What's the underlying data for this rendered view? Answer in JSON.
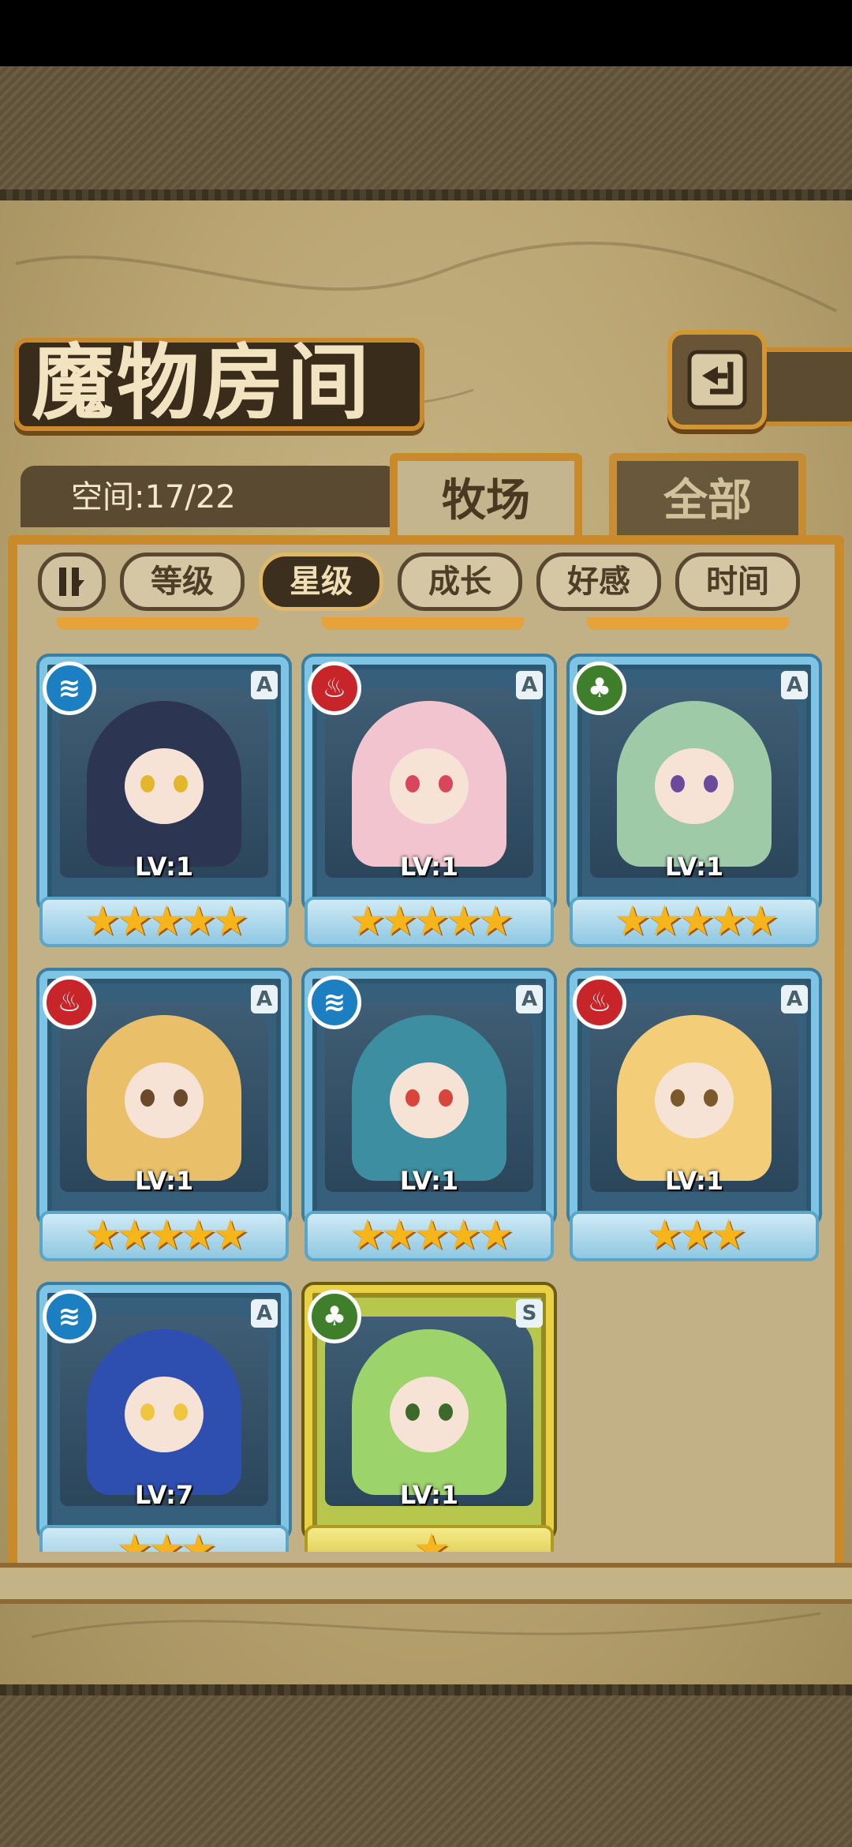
{
  "title": "魔物房间",
  "space": {
    "label": "空间:17/22"
  },
  "tabs": [
    {
      "label": "牧场",
      "active": true
    },
    {
      "label": "全部",
      "active": false
    }
  ],
  "sort_buttons": [
    {
      "label": "等级",
      "active": false
    },
    {
      "label": "星级",
      "active": true
    },
    {
      "label": "成长",
      "active": false
    },
    {
      "label": "好感",
      "active": false
    },
    {
      "label": "时间",
      "active": false
    }
  ],
  "monsters": [
    {
      "element": "water",
      "rank": "A",
      "level": "LV:1",
      "stars": "★★★★★",
      "hair": "#2c3552",
      "eye": "#e3b62c"
    },
    {
      "element": "fire",
      "rank": "A",
      "level": "LV:1",
      "stars": "★★★★★",
      "hair": "#f2c4cf",
      "eye": "#d9455b"
    },
    {
      "element": "wood",
      "rank": "A",
      "level": "LV:1",
      "stars": "★★★★★",
      "hair": "#9fcaa8",
      "eye": "#6b4a9c"
    },
    {
      "element": "fire",
      "rank": "A",
      "level": "LV:1",
      "stars": "★★★★★",
      "hair": "#e9c069",
      "eye": "#6a4a2a"
    },
    {
      "element": "water",
      "rank": "A",
      "level": "LV:1",
      "stars": "★★★★★",
      "hair": "#3d8ea0",
      "eye": "#d9453a"
    },
    {
      "element": "fire",
      "rank": "A",
      "level": "LV:1",
      "stars": "★★★",
      "hair": "#f3cd78",
      "eye": "#7a5a2a"
    },
    {
      "element": "water",
      "rank": "A",
      "level": "LV:7",
      "stars": "★★★",
      "hair": "#2f4fb0",
      "eye": "#f0c640"
    },
    {
      "element": "wood",
      "rank": "S",
      "level": "LV:1",
      "stars": "★",
      "hair": "#9cd36a",
      "eye": "#3d6a2a"
    }
  ],
  "colors": {
    "accent": "#c98a2b",
    "parchment": "#c8b98e",
    "water": "#1b7fc2",
    "fire": "#c8252a",
    "wood": "#3f7f2b"
  }
}
